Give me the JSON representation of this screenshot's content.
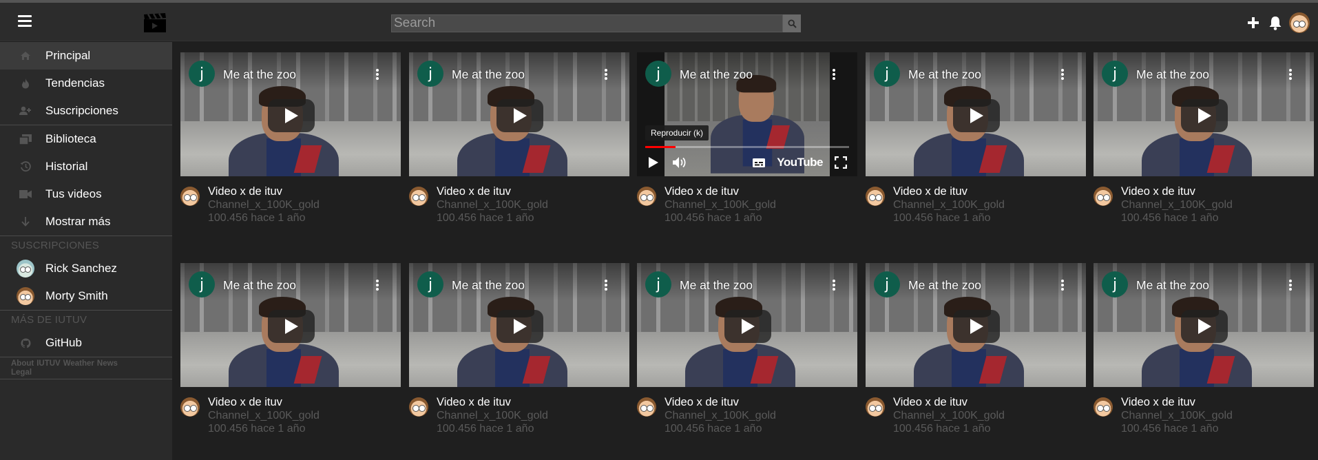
{
  "header": {
    "search_placeholder": "Search",
    "icons": [
      "menu-icon",
      "clapperboard-logo-icon",
      "search-icon",
      "plus-icon",
      "bell-icon",
      "user-avatar"
    ]
  },
  "sidebar": {
    "items": [
      {
        "label": "Principal",
        "icon": "home-icon",
        "active": true
      },
      {
        "label": "Tendencias",
        "icon": "flame-icon"
      },
      {
        "label": "Suscripciones",
        "icon": "subscriptions-icon"
      },
      {
        "label": "Biblioteca",
        "icon": "library-icon"
      },
      {
        "label": "Historial",
        "icon": "history-icon"
      },
      {
        "label": "Tus videos",
        "icon": "video-camera-icon"
      },
      {
        "label": "Mostrar más",
        "icon": "arrow-down-icon"
      }
    ],
    "subs_heading": "SUSCRIPCIONES",
    "subscriptions": [
      {
        "label": "Rick Sanchez"
      },
      {
        "label": "Morty Smith"
      }
    ],
    "more_heading": "MÁS DE IUTUV",
    "more": [
      {
        "label": "GitHub",
        "icon": "github-icon"
      }
    ],
    "footer_links": [
      "About",
      "IUTUV",
      "Weather",
      "News",
      "Legal"
    ]
  },
  "videos": [
    {
      "embed_title": "Me at the zoo",
      "channel_initial": "j",
      "title": "Video x de ituv",
      "channel": "Channel_x_100K_gold",
      "stats": "100.456 hace 1 año"
    },
    {
      "embed_title": "Me at the zoo",
      "channel_initial": "j",
      "title": "Video x de ituv",
      "channel": "Channel_x_100K_gold",
      "stats": "100.456 hace 1 año"
    },
    {
      "embed_title": "Me at the zoo",
      "channel_initial": "j",
      "title": "Video x de ituv",
      "channel": "Channel_x_100K_gold",
      "stats": "100.456 hace 1 año",
      "tooltip": "Reproducir (k)",
      "brand": "YouTube",
      "progress": 0.15
    },
    {
      "embed_title": "Me at the zoo",
      "channel_initial": "j",
      "title": "Video x de ituv",
      "channel": "Channel_x_100K_gold",
      "stats": "100.456 hace 1 año"
    },
    {
      "embed_title": "Me at the zoo",
      "channel_initial": "j",
      "title": "Video x de ituv",
      "channel": "Channel_x_100K_gold",
      "stats": "100.456 hace 1 año"
    },
    {
      "embed_title": "Me at the zoo",
      "channel_initial": "j",
      "title": "Video x de ituv",
      "channel": "Channel_x_100K_gold",
      "stats": "100.456 hace 1 año"
    },
    {
      "embed_title": "Me at the zoo",
      "channel_initial": "j",
      "title": "Video x de ituv",
      "channel": "Channel_x_100K_gold",
      "stats": "100.456 hace 1 año"
    },
    {
      "embed_title": "Me at the zoo",
      "channel_initial": "j",
      "title": "Video x de ituv",
      "channel": "Channel_x_100K_gold",
      "stats": "100.456 hace 1 año"
    },
    {
      "embed_title": "Me at the zoo",
      "channel_initial": "j",
      "title": "Video x de ituv",
      "channel": "Channel_x_100K_gold",
      "stats": "100.456 hace 1 año"
    },
    {
      "embed_title": "Me at the zoo",
      "channel_initial": "j",
      "title": "Video x de ituv",
      "channel": "Channel_x_100K_gold",
      "stats": "100.456 hace 1 año"
    }
  ],
  "colors": {
    "background": "#1f1f1f",
    "sidebar": "#2a2a2a",
    "header": "#2c2c2c",
    "channel_avatar": "#0f5d4b",
    "progress": "#ff0000"
  }
}
